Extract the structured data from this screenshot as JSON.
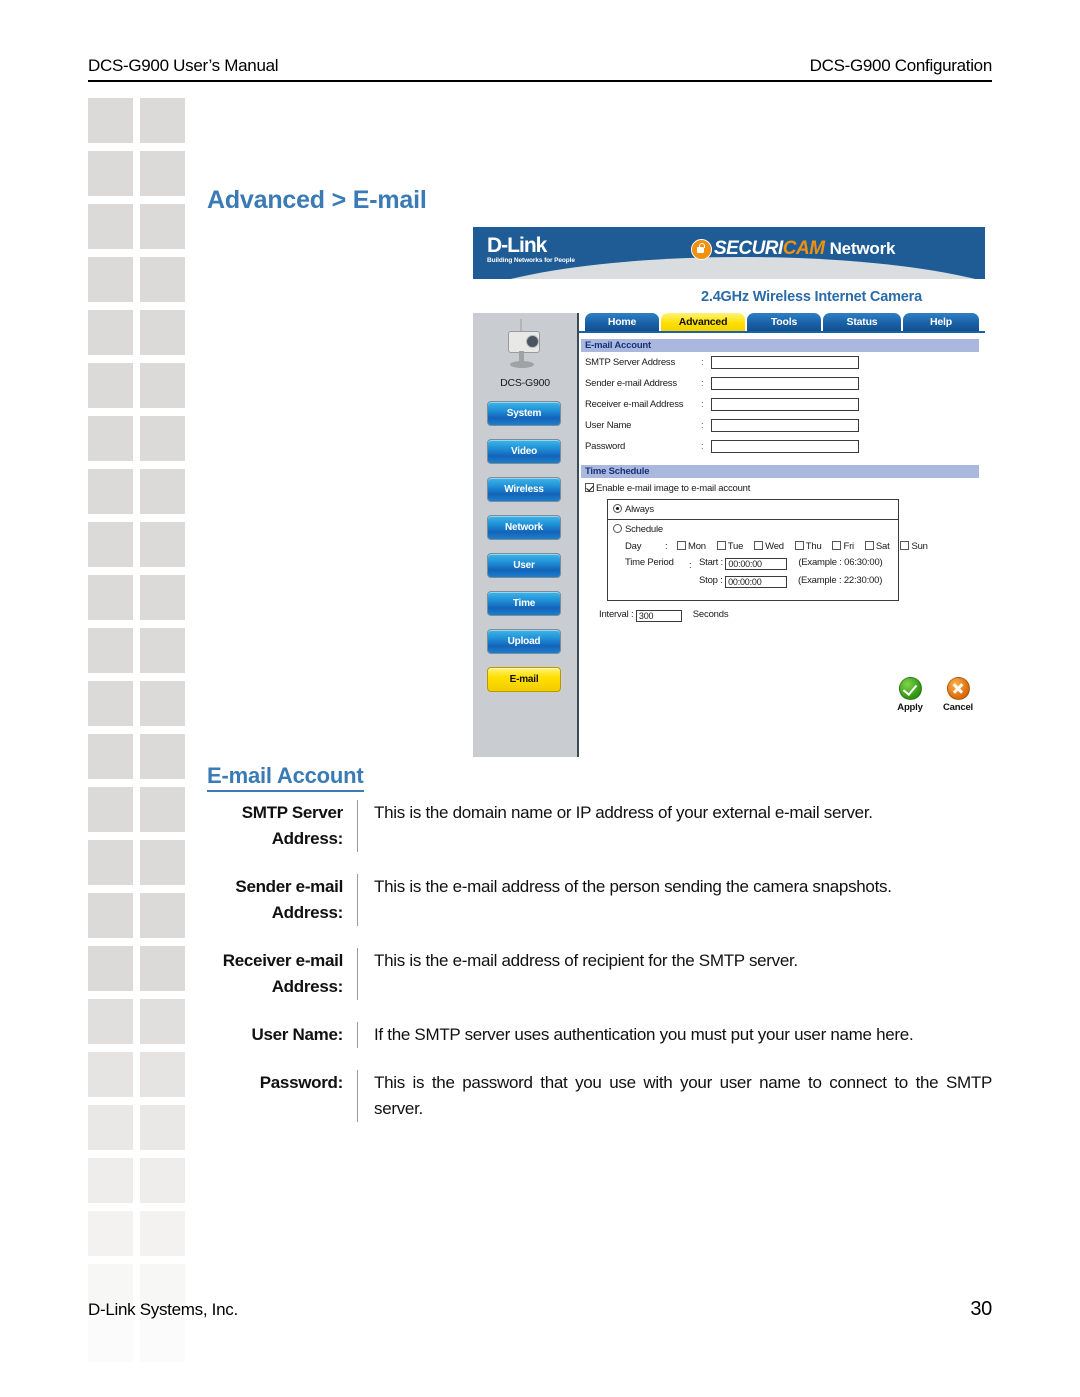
{
  "header": {
    "left": "DCS-G900 User’s Manual",
    "right": "DCS-G900 Configuration"
  },
  "page_title": "Advanced > E-mail",
  "accent_color": "#3a7ab5",
  "screenshot": {
    "brand": "D-Link",
    "brand_tagline": "Building Networks for People",
    "securicam": {
      "word1": "SECURI",
      "word2": "CAM",
      "word3": "Network",
      "lock_icon": "lock-icon"
    },
    "subtitle": "2.4GHz Wireless Internet Camera",
    "tabs": [
      {
        "label": "Home",
        "active": false
      },
      {
        "label": "Advanced",
        "active": true
      },
      {
        "label": "Tools",
        "active": false
      },
      {
        "label": "Status",
        "active": false
      },
      {
        "label": "Help",
        "active": false
      }
    ],
    "device_label": "DCS-G900",
    "rail_buttons": [
      {
        "label": "System",
        "active": false
      },
      {
        "label": "Video",
        "active": false
      },
      {
        "label": "Wireless",
        "active": false
      },
      {
        "label": "Network",
        "active": false
      },
      {
        "label": "User",
        "active": false
      },
      {
        "label": "Time",
        "active": false
      },
      {
        "label": "Upload",
        "active": false
      },
      {
        "label": "E-mail",
        "active": true
      }
    ],
    "email_account": {
      "section_title": "E-mail Account",
      "fields": [
        {
          "label": "SMTP Server Address",
          "value": ""
        },
        {
          "label": "Sender e-mail Address",
          "value": ""
        },
        {
          "label": "Receiver e-mail Address",
          "value": ""
        },
        {
          "label": "User Name",
          "value": ""
        },
        {
          "label": "Password",
          "value": ""
        }
      ],
      "colon": ":"
    },
    "time_schedule": {
      "section_title": "Time Schedule",
      "enable_label": "Enable e-mail image to e-mail account",
      "enable_checked": true,
      "always_label": "Always",
      "always_selected": true,
      "schedule_label": "Schedule",
      "schedule_selected": false,
      "day_label": "Day",
      "day_colon": ":",
      "days": [
        {
          "label": "Mon",
          "checked": false
        },
        {
          "label": "Tue",
          "checked": false
        },
        {
          "label": "Wed",
          "checked": false
        },
        {
          "label": "Thu",
          "checked": false
        },
        {
          "label": "Fri",
          "checked": false
        },
        {
          "label": "Sat",
          "checked": false
        },
        {
          "label": "Sun",
          "checked": false
        }
      ],
      "time_period_label": "Time Period",
      "time_period_colon": ":",
      "start_label": "Start :",
      "start_value": "00:00:00",
      "start_example": "(Example : 06:30:00)",
      "stop_label": "Stop :",
      "stop_value": "00:00:00",
      "stop_example": "(Example : 22:30:00)",
      "interval_label": "Interval :",
      "interval_value": "300",
      "interval_unit": "Seconds"
    },
    "actions": [
      {
        "label": "Apply",
        "icon": "green-check-icon"
      },
      {
        "label": "Cancel",
        "icon": "orange-x-icon"
      }
    ]
  },
  "definitions": {
    "title": "E-mail Account",
    "items": [
      {
        "term": "SMTP Server Address:",
        "desc": "This is the domain name or IP address of your external e-mail server.",
        "justify": false
      },
      {
        "term": "Sender e-mail Address:",
        "desc": "This is the e-mail address of the person sending the camera snapshots.",
        "justify": true
      },
      {
        "term": "Receiver e-mail Address:",
        "desc": "This is the e-mail address of recipient for the SMTP server.",
        "justify": false
      },
      {
        "term": "User Name:",
        "desc": "If the SMTP server uses authentication you must put your user name here.",
        "justify": true
      },
      {
        "term": "Password:",
        "desc": "This is the password that you use with your user name to connect to the SMTP server.",
        "justify": true
      }
    ]
  },
  "footer": {
    "company": "D-Link Systems, Inc.",
    "page_number": "30"
  }
}
